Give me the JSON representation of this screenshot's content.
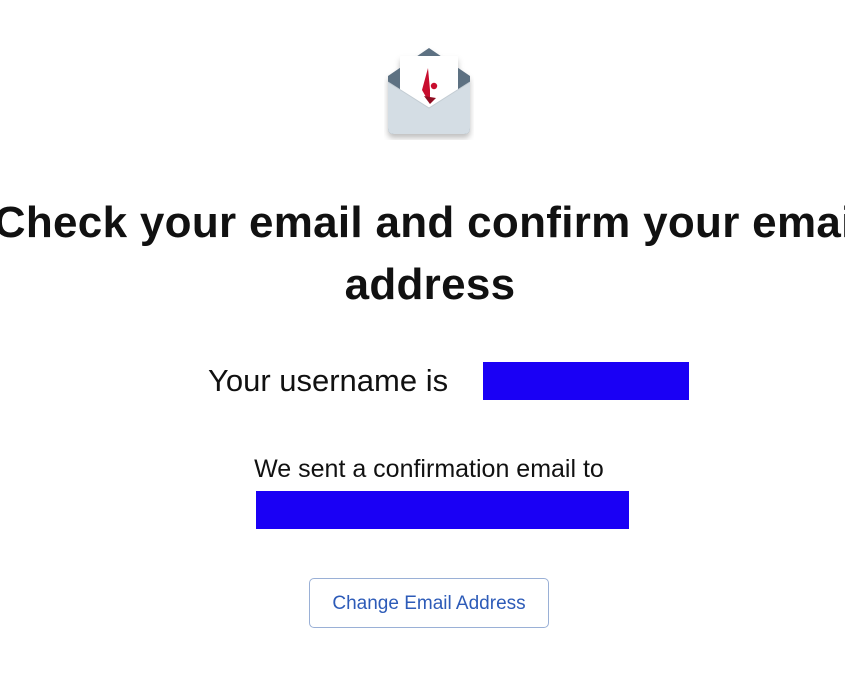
{
  "header": {
    "icon": "envelope-with-letter-icon",
    "accent_color": "#c8102e"
  },
  "main": {
    "headline_line1": "Check your email and confirm your email",
    "headline_line2": "address",
    "username_label": "Your username is",
    "sent_text": "We sent a confirmation email to",
    "change_email_label": "Change Email Address"
  },
  "colors": {
    "redaction": "#1a00f5",
    "button_text": "#2d5bb8",
    "button_border": "#9ab0d6"
  }
}
